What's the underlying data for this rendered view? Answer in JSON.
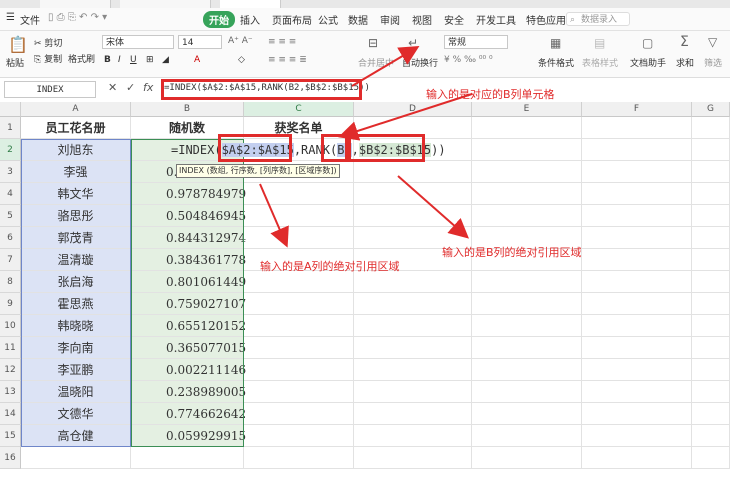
{
  "menu": {
    "file": "文件",
    "items": [
      "开始",
      "插入",
      "页面布局",
      "公式",
      "数据",
      "审阅",
      "视图",
      "安全",
      "开发工具",
      "特色应用"
    ],
    "search": "数据录入"
  },
  "ribbon": {
    "paste": "粘贴",
    "cut": "剪切",
    "copy": "复制",
    "format_painter": "格式刷",
    "font_name": "宋体",
    "font_size": "14",
    "merge_center": "合并居中",
    "wrap_text": "自动换行",
    "number_format": "常规",
    "conditional_format": "条件格式",
    "table_style": "表格样式",
    "doc_helper": "文档助手",
    "sum": "求和",
    "filter": "筛选"
  },
  "formula_bar": {
    "name_box": "INDEX",
    "fx": "fx",
    "formula": "=INDEX($A$2:$A$15,RANK(B2,$B$2:$B$15))"
  },
  "columns": [
    "A",
    "B",
    "C",
    "D",
    "E",
    "F",
    "G"
  ],
  "headers": {
    "a": "员工花名册",
    "b": "随机数",
    "c": "获奖名单"
  },
  "rows": [
    {
      "n": "1"
    },
    {
      "n": "2",
      "name": "刘旭东"
    },
    {
      "n": "3",
      "name": "李强",
      "val": "0."
    },
    {
      "n": "4",
      "name": "韩文华",
      "val": "0.978784979"
    },
    {
      "n": "5",
      "name": "骆思彤",
      "val": "0.504846945"
    },
    {
      "n": "6",
      "name": "郭茂青",
      "val": "0.844312974"
    },
    {
      "n": "7",
      "name": "温清璇",
      "val": "0.384361778"
    },
    {
      "n": "8",
      "name": "张启海",
      "val": "0.801061449"
    },
    {
      "n": "9",
      "name": "霍思燕",
      "val": "0.759027107"
    },
    {
      "n": "10",
      "name": "韩晓晓",
      "val": "0.655120152"
    },
    {
      "n": "11",
      "name": "李向南",
      "val": "0.365077015"
    },
    {
      "n": "12",
      "name": "李亚鹏",
      "val": "0.002211146"
    },
    {
      "n": "13",
      "name": "温晓阳",
      "val": "0.238989005"
    },
    {
      "n": "14",
      "name": "文德华",
      "val": "0.774662642"
    },
    {
      "n": "15",
      "name": "高仓健",
      "val": "0.059929915"
    },
    {
      "n": "16"
    }
  ],
  "editing": {
    "p1": "=INDEX(",
    "p2": "$A$2:$A$15",
    "p3": ",RANK(",
    "p4": "B2",
    "p5": ",",
    "p6": "$B$2:$B$15",
    "p7": "))"
  },
  "tooltip": "INDEX (数组, 行序数, [列序数], [区域序数])",
  "annotations": {
    "top": "输入的是对应的B列单元格",
    "left": "输入的是A列的绝对引用区域",
    "right": "输入的是B列的绝对引用区域"
  }
}
